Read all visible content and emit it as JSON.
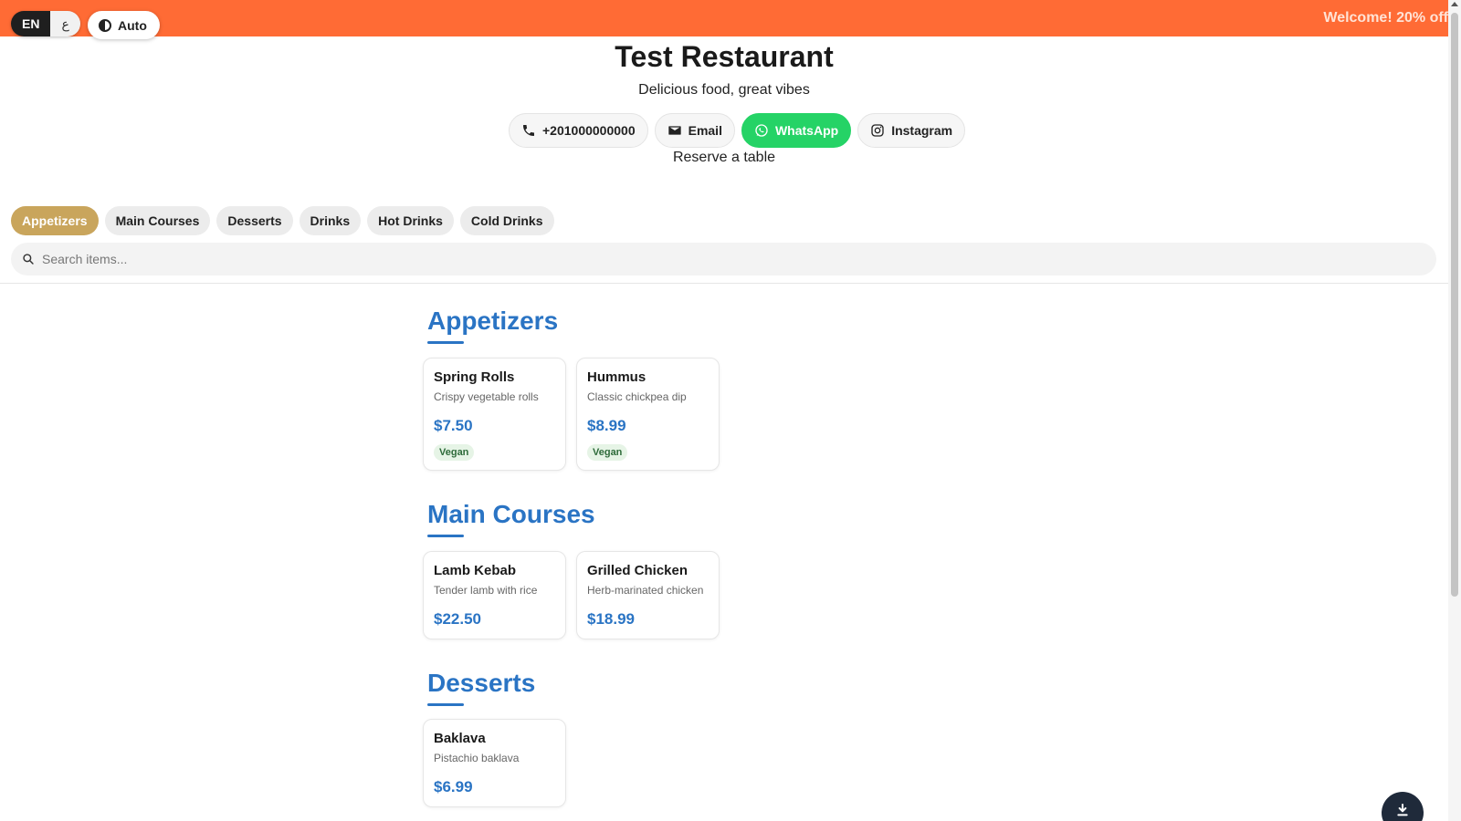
{
  "banner": {
    "text": "Welcome! 20% off"
  },
  "lang": {
    "active": "EN",
    "alt": "ع"
  },
  "theme": {
    "label": "Auto"
  },
  "restaurant": {
    "name": "Test Restaurant",
    "tagline": "Delicious food, great vibes",
    "reserve": "Reserve a table"
  },
  "contacts": {
    "phone": "+201000000000",
    "email": "Email",
    "whatsapp": "WhatsApp",
    "instagram": "Instagram"
  },
  "tabs": [
    "Appetizers",
    "Main Courses",
    "Desserts",
    "Drinks",
    "Hot Drinks",
    "Cold Drinks"
  ],
  "search": {
    "placeholder": "Search items..."
  },
  "sections": [
    {
      "title": "Appetizers",
      "items": [
        {
          "name": "Spring Rolls",
          "desc": "Crispy vegetable rolls",
          "price": "$7.50",
          "tag": "Vegan"
        },
        {
          "name": "Hummus",
          "desc": "Classic chickpea dip",
          "price": "$8.99",
          "tag": "Vegan"
        }
      ]
    },
    {
      "title": "Main Courses",
      "items": [
        {
          "name": "Lamb Kebab",
          "desc": "Tender lamb with rice",
          "price": "$22.50"
        },
        {
          "name": "Grilled Chicken",
          "desc": "Herb-marinated chicken",
          "price": "$18.99"
        }
      ]
    },
    {
      "title": "Desserts",
      "items": [
        {
          "name": "Baklava",
          "desc": "Pistachio baklava",
          "price": "$6.99"
        }
      ]
    }
  ],
  "colors": {
    "banner": "#ff6b35",
    "accent": "#2a74c4",
    "active_tab": "#c9a55c",
    "whatsapp": "#25d366"
  },
  "icons": {
    "phone": "phone-icon",
    "email": "mail-icon",
    "whatsapp": "whatsapp-icon",
    "instagram": "instagram-icon",
    "search": "search-icon",
    "theme": "contrast-icon",
    "download": "download-icon"
  }
}
